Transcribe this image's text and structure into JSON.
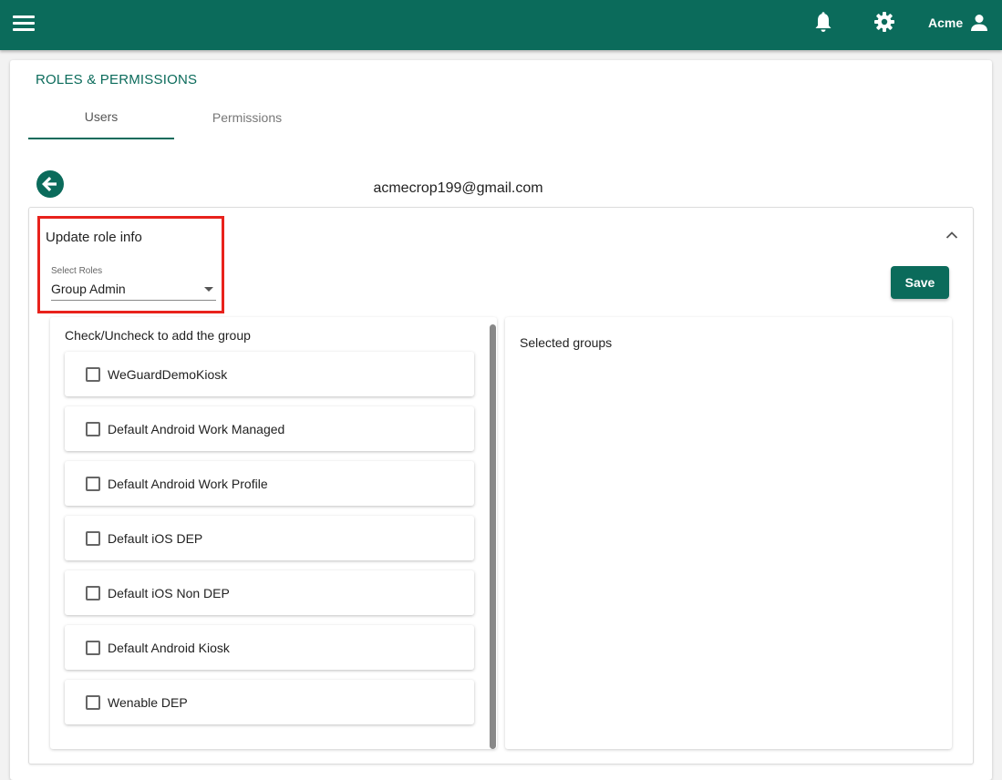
{
  "header": {
    "menu_icon": "hamburger-menu-icon",
    "notification_icon": "bell-icon",
    "settings_icon": "gear-icon",
    "user_name": "Acme",
    "user_icon": "person-icon",
    "brand_color": "#0b6b5b"
  },
  "page": {
    "title": "ROLES & PERMISSIONS",
    "tabs": [
      {
        "label": "Users",
        "active": true
      },
      {
        "label": "Permissions",
        "active": false
      }
    ],
    "back_icon": "arrow-left-circle-icon",
    "email": "acmecrop199@gmail.com"
  },
  "role_panel": {
    "title": "Update role info",
    "select_label": "Select Roles",
    "select_value": "Group Admin",
    "save_label": "Save",
    "collapse_icon": "chevron-up-icon",
    "highlight_color": "#e8221c"
  },
  "groups": {
    "heading": "Check/Uncheck to add the group",
    "items": [
      {
        "label": "WeGuardDemoKiosk",
        "checked": false
      },
      {
        "label": "Default Android Work Managed",
        "checked": false
      },
      {
        "label": "Default Android Work Profile",
        "checked": false
      },
      {
        "label": "Default iOS DEP",
        "checked": false
      },
      {
        "label": "Default iOS Non DEP",
        "checked": false
      },
      {
        "label": "Default Android Kiosk",
        "checked": false
      },
      {
        "label": "Wenable DEP",
        "checked": false
      }
    ]
  },
  "selected_groups": {
    "heading": "Selected groups"
  }
}
